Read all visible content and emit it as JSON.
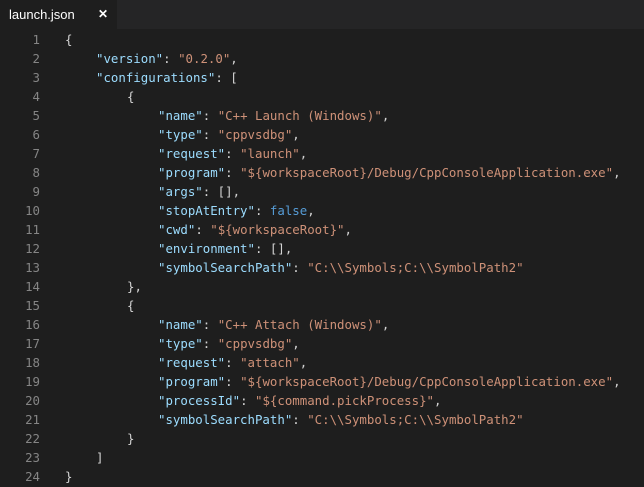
{
  "tab": {
    "label": "launch.json",
    "close_glyph": "✕"
  },
  "colors": {
    "key": "#9cdcfe",
    "string": "#ce9178",
    "boolean": "#569cd6",
    "punct": "#d4d4d4",
    "line_number": "#858585",
    "background": "#1e1e1e"
  },
  "lines": [
    {
      "n": "1",
      "indent": 0,
      "tokens": [
        [
          "p",
          "{"
        ]
      ]
    },
    {
      "n": "2",
      "indent": 1,
      "tokens": [
        [
          "k",
          "\"version\""
        ],
        [
          "p",
          ": "
        ],
        [
          "s",
          "\"0.2.0\""
        ],
        [
          "p",
          ","
        ]
      ]
    },
    {
      "n": "3",
      "indent": 1,
      "tokens": [
        [
          "k",
          "\"configurations\""
        ],
        [
          "p",
          ": ["
        ]
      ]
    },
    {
      "n": "4",
      "indent": 2,
      "tokens": [
        [
          "p",
          "{"
        ]
      ]
    },
    {
      "n": "5",
      "indent": 3,
      "tokens": [
        [
          "k",
          "\"name\""
        ],
        [
          "p",
          ": "
        ],
        [
          "s",
          "\"C++ Launch (Windows)\""
        ],
        [
          "p",
          ","
        ]
      ]
    },
    {
      "n": "6",
      "indent": 3,
      "tokens": [
        [
          "k",
          "\"type\""
        ],
        [
          "p",
          ": "
        ],
        [
          "s",
          "\"cppvsdbg\""
        ],
        [
          "p",
          ","
        ]
      ]
    },
    {
      "n": "7",
      "indent": 3,
      "tokens": [
        [
          "k",
          "\"request\""
        ],
        [
          "p",
          ": "
        ],
        [
          "s",
          "\"launch\""
        ],
        [
          "p",
          ","
        ]
      ]
    },
    {
      "n": "8",
      "indent": 3,
      "tokens": [
        [
          "k",
          "\"program\""
        ],
        [
          "p",
          ": "
        ],
        [
          "s",
          "\"${workspaceRoot}/Debug/CppConsoleApplication.exe\""
        ],
        [
          "p",
          ","
        ]
      ]
    },
    {
      "n": "9",
      "indent": 3,
      "tokens": [
        [
          "k",
          "\"args\""
        ],
        [
          "p",
          ": [],"
        ]
      ]
    },
    {
      "n": "10",
      "indent": 3,
      "tokens": [
        [
          "k",
          "\"stopAtEntry\""
        ],
        [
          "p",
          ": "
        ],
        [
          "b",
          "false"
        ],
        [
          "p",
          ","
        ]
      ]
    },
    {
      "n": "11",
      "indent": 3,
      "tokens": [
        [
          "k",
          "\"cwd\""
        ],
        [
          "p",
          ": "
        ],
        [
          "s",
          "\"${workspaceRoot}\""
        ],
        [
          "p",
          ","
        ]
      ]
    },
    {
      "n": "12",
      "indent": 3,
      "tokens": [
        [
          "k",
          "\"environment\""
        ],
        [
          "p",
          ": [],"
        ]
      ]
    },
    {
      "n": "13",
      "indent": 3,
      "tokens": [
        [
          "k",
          "\"symbolSearchPath\""
        ],
        [
          "p",
          ": "
        ],
        [
          "s",
          "\"C:\\\\Symbols;C:\\\\SymbolPath2\""
        ]
      ]
    },
    {
      "n": "14",
      "indent": 2,
      "tokens": [
        [
          "p",
          "},"
        ]
      ]
    },
    {
      "n": "15",
      "indent": 2,
      "tokens": [
        [
          "p",
          "{"
        ]
      ]
    },
    {
      "n": "16",
      "indent": 3,
      "tokens": [
        [
          "k",
          "\"name\""
        ],
        [
          "p",
          ": "
        ],
        [
          "s",
          "\"C++ Attach (Windows)\""
        ],
        [
          "p",
          ","
        ]
      ]
    },
    {
      "n": "17",
      "indent": 3,
      "tokens": [
        [
          "k",
          "\"type\""
        ],
        [
          "p",
          ": "
        ],
        [
          "s",
          "\"cppvsdbg\""
        ],
        [
          "p",
          ","
        ]
      ]
    },
    {
      "n": "18",
      "indent": 3,
      "tokens": [
        [
          "k",
          "\"request\""
        ],
        [
          "p",
          ": "
        ],
        [
          "s",
          "\"attach\""
        ],
        [
          "p",
          ","
        ]
      ]
    },
    {
      "n": "19",
      "indent": 3,
      "tokens": [
        [
          "k",
          "\"program\""
        ],
        [
          "p",
          ": "
        ],
        [
          "s",
          "\"${workspaceRoot}/Debug/CppConsoleApplication.exe\""
        ],
        [
          "p",
          ","
        ]
      ]
    },
    {
      "n": "20",
      "indent": 3,
      "tokens": [
        [
          "k",
          "\"processId\""
        ],
        [
          "p",
          ": "
        ],
        [
          "s",
          "\"${command.pickProcess}\""
        ],
        [
          "p",
          ","
        ]
      ]
    },
    {
      "n": "21",
      "indent": 3,
      "tokens": [
        [
          "k",
          "\"symbolSearchPath\""
        ],
        [
          "p",
          ": "
        ],
        [
          "s",
          "\"C:\\\\Symbols;C:\\\\SymbolPath2\""
        ]
      ]
    },
    {
      "n": "22",
      "indent": 2,
      "tokens": [
        [
          "p",
          "}"
        ]
      ]
    },
    {
      "n": "23",
      "indent": 1,
      "tokens": [
        [
          "p",
          "]"
        ]
      ]
    },
    {
      "n": "24",
      "indent": 0,
      "tokens": [
        [
          "p",
          "}"
        ]
      ]
    }
  ]
}
